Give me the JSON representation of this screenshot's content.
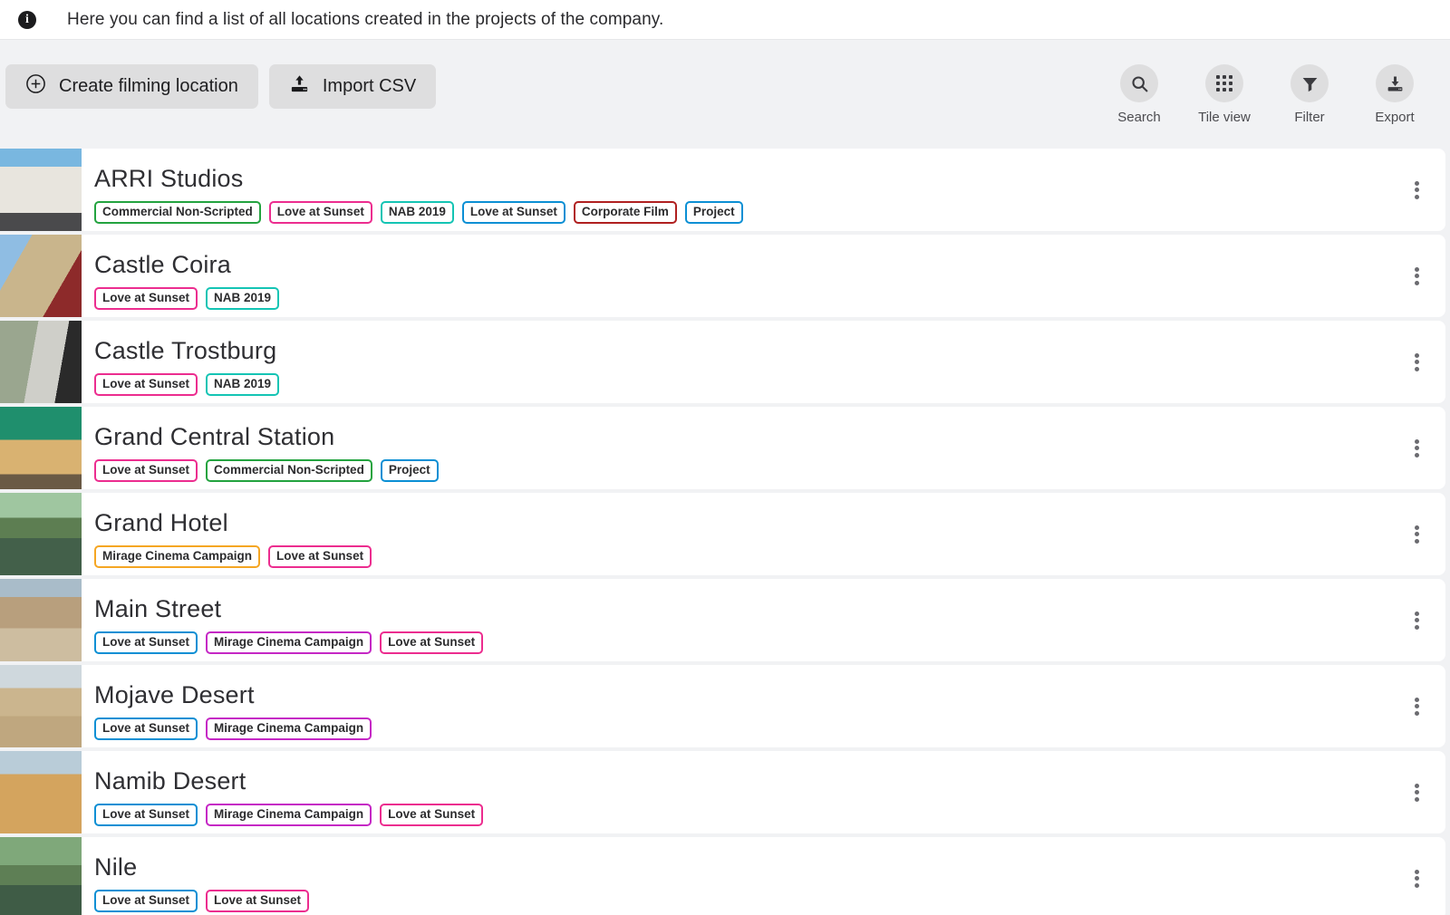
{
  "banner": {
    "icon": "info-icon",
    "text": "Here you can find a list of all locations created in the projects of the company."
  },
  "toolbar": {
    "create_label": "Create filming location",
    "create_icon": "plus-circle-icon",
    "import_label": "Import CSV",
    "import_icon": "upload-icon",
    "tools": [
      {
        "label": "Search",
        "icon": "search-icon"
      },
      {
        "label": "Tile view",
        "icon": "grid-icon"
      },
      {
        "label": "Filter",
        "icon": "funnel-icon"
      },
      {
        "label": "Export",
        "icon": "download-icon"
      }
    ]
  },
  "tag_colors": {
    "green": "#23a33f",
    "pink": "#ec2d8f",
    "teal": "#14c4b4",
    "blue": "#0b8fd4",
    "darkred": "#b02020",
    "orange": "#f5a623",
    "magenta": "#c527c5"
  },
  "row_menu_icon": "kebab-menu-icon",
  "rows": [
    {
      "title": "ARRI Studios",
      "thumb": "building-facade-photo",
      "tags": [
        {
          "label": "Commercial Non-Scripted",
          "color": "green"
        },
        {
          "label": "Love at Sunset",
          "color": "pink"
        },
        {
          "label": "NAB 2019",
          "color": "teal"
        },
        {
          "label": "Love at Sunset",
          "color": "blue"
        },
        {
          "label": "Corporate Film",
          "color": "darkred"
        },
        {
          "label": "Project",
          "color": "blue"
        }
      ]
    },
    {
      "title": "Castle Coira",
      "thumb": "castle-with-red-vines-photo",
      "tags": [
        {
          "label": "Love at Sunset",
          "color": "pink"
        },
        {
          "label": "NAB 2019",
          "color": "teal"
        }
      ]
    },
    {
      "title": "Castle Trostburg",
      "thumb": "castle-window-view-photo",
      "tags": [
        {
          "label": "Love at Sunset",
          "color": "pink"
        },
        {
          "label": "NAB 2019",
          "color": "teal"
        }
      ]
    },
    {
      "title": "Grand Central Station",
      "thumb": "green-ceiling-hall-photo",
      "tags": [
        {
          "label": "Love at Sunset",
          "color": "pink"
        },
        {
          "label": "Commercial Non-Scripted",
          "color": "green"
        },
        {
          "label": "Project",
          "color": "blue"
        }
      ]
    },
    {
      "title": "Grand Hotel",
      "thumb": "palm-lagoon-reflection-photo",
      "tags": [
        {
          "label": "Mirage Cinema Campaign",
          "color": "orange"
        },
        {
          "label": "Love at Sunset",
          "color": "pink"
        }
      ]
    },
    {
      "title": "Main Street",
      "thumb": "arid-valley-photo",
      "tags": [
        {
          "label": "Love at Sunset",
          "color": "blue"
        },
        {
          "label": "Mirage Cinema Campaign",
          "color": "magenta"
        },
        {
          "label": "Love at Sunset",
          "color": "pink"
        }
      ]
    },
    {
      "title": "Mojave Desert",
      "thumb": "desert-camp-photo",
      "tags": [
        {
          "label": "Love at Sunset",
          "color": "blue"
        },
        {
          "label": "Mirage Cinema Campaign",
          "color": "magenta"
        }
      ]
    },
    {
      "title": "Namib Desert",
      "thumb": "sand-dunes-photo",
      "tags": [
        {
          "label": "Love at Sunset",
          "color": "blue"
        },
        {
          "label": "Mirage Cinema Campaign",
          "color": "magenta"
        },
        {
          "label": "Love at Sunset",
          "color": "pink"
        }
      ]
    },
    {
      "title": "Nile",
      "thumb": "river-palms-reflection-photo",
      "tags": [
        {
          "label": "Love at Sunset",
          "color": "blue"
        },
        {
          "label": "Love at Sunset",
          "color": "pink"
        }
      ]
    }
  ]
}
